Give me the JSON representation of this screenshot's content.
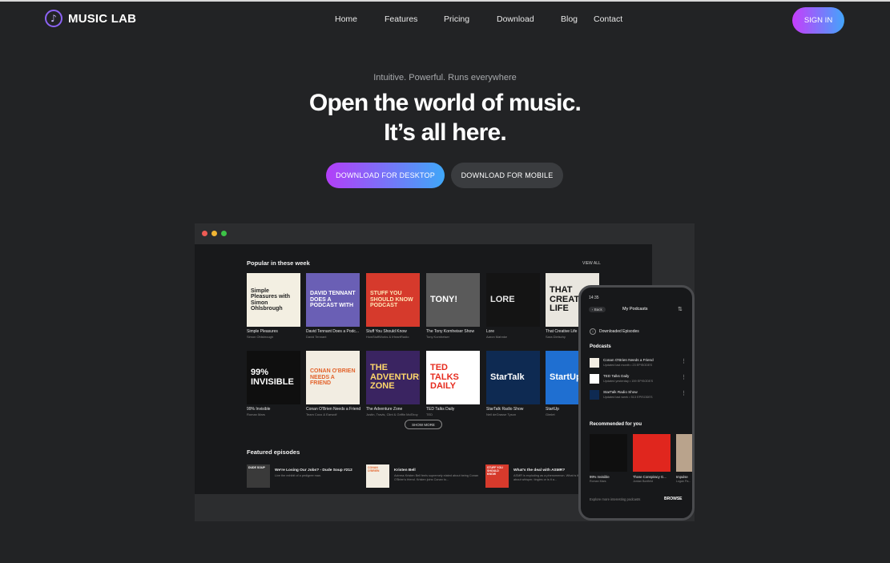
{
  "app": {
    "name": "MUSIC LAB"
  },
  "nav": {
    "items": [
      "Home",
      "Features",
      "Pricing",
      "Download",
      "Blog",
      "Contact"
    ]
  },
  "header": {
    "signin_label": "SIGN IN"
  },
  "hero": {
    "eyebrow": "Intuitive. Powerful. Runs everywhere",
    "headline_line1": "Open the world of music.",
    "headline_line2": "It’s all here.",
    "cta_desktop": "DOWNLOAD FOR DESKTOP",
    "cta_mobile": "DOWNLOAD FOR MOBILE"
  },
  "desktop_app": {
    "popular_title": "Popular in these week",
    "view_all": "VIEW ALL",
    "show_more": "SHOW MORE",
    "featured_title": "Featured episodes",
    "podcasts": [
      {
        "title": "Simple Pleasures",
        "author": "Simon Ohlsbrough",
        "art": "Simple Pleasures with Simon Ohlsbrough",
        "bg": "#f3efe2",
        "fg": "#222"
      },
      {
        "title": "David Tennant Does a Podc...",
        "author": "David Tennant",
        "art": "DAVID TENNANT DOES A PODCAST WITH",
        "bg": "#6a5fb5",
        "fg": "#ffffff"
      },
      {
        "title": "Stuff You Should Know",
        "author": "HowStuffWorks & iHeartRadio",
        "art": "STUFF YOU SHOULD KNOW PODCAST",
        "bg": "#d63a2c",
        "fg": "#ffe8b8"
      },
      {
        "title": "The Tony Kornheiser Show",
        "author": "Tony Kornheiser",
        "art": "TONY!",
        "bg": "#5a5a5a",
        "fg": "#ffffff"
      },
      {
        "title": "Lore",
        "author": "Aaron Mahnke",
        "art": "LORE",
        "bg": "#141414",
        "fg": "#e6e6e6"
      },
      {
        "title": "That Creative Life",
        "author": "Sara Dietschy",
        "art": "THAT CREATIVE LIFE",
        "bg": "#e9e6df",
        "fg": "#111111"
      },
      {
        "title": "99% Invisible",
        "author": "Roman Mars",
        "art": "99% INVISIBLE",
        "bg": "#0f0f0f",
        "fg": "#ffffff"
      },
      {
        "title": "Conan O'Brien Needs a Friend",
        "author": "Team Coco & Earwolf",
        "art": "CONAN O'BRIEN NEEDS A FRIEND",
        "bg": "#f2ede2",
        "fg": "#e3632b"
      },
      {
        "title": "The Adventure Zone",
        "author": "Justin, Travis, Clint & Griffin McElroy",
        "art": "THE ADVENTURE ZONE",
        "bg": "#3a2461",
        "fg": "#ffd86b"
      },
      {
        "title": "TED Talks Daily",
        "author": "TED",
        "art": "TED TALKS DAILY",
        "bg": "#ffffff",
        "fg": "#e62b1e"
      },
      {
        "title": "StarTalk Radio Show",
        "author": "Neil deGrasse Tyson",
        "art": "StarTalk",
        "bg": "#0e2a52",
        "fg": "#ffffff"
      },
      {
        "title": "StartUp",
        "author": "Gimlet",
        "art": "StartUp",
        "bg": "#1f6fd1",
        "fg": "#ffffff"
      }
    ],
    "featured": [
      {
        "show": "DUDE SOUP",
        "title": "We're Losing Our Jobs? - Dude Soup #212",
        "desc": "Live the exhibit of a pedigree man.",
        "bg": "#3a3a3a"
      },
      {
        "show": "CONAN O'BRIEN",
        "title": "Kristen Bell",
        "desc": "Actress Kristen Bell feels supremely elated about being Conan O'Brien's friend. Kristen joins Conan to...",
        "bg": "#f2ede2"
      },
      {
        "show": "STUFF YOU SHOULD KNOW",
        "title": "What's the deal with ASMR?",
        "desc": "ASMR is exploding as a phenomenon. What is it exactly? Is it about whisper, tingles or is it a...",
        "bg": "#d63a2c"
      }
    ]
  },
  "mobile_app": {
    "time": "14:35",
    "back_label": "Back",
    "title": "My Podcasts",
    "downloaded": "Downloaded Episodes",
    "podcasts_title": "Podcasts",
    "list": [
      {
        "title": "Conan O'Brien Needs a Friend",
        "meta": "Updated last month • 23 EPISODES",
        "bg": "#f2ede2"
      },
      {
        "title": "TED Talks Daily",
        "meta": "Updated yesterday • 159 EPISODES",
        "bg": "#ffffff"
      },
      {
        "title": "StarTalk Radio Show",
        "meta": "Updated last week • 513 EPISODES",
        "bg": "#0e2a52"
      }
    ],
    "recommended_title": "Recommended for you",
    "recommended": [
      {
        "title": "99% Invisible",
        "author": "Roman Mars",
        "bg": "#0f0f0f",
        "fg": "#ffffff"
      },
      {
        "title": "Those Conspiracy G...",
        "author": "Jordan Bonfield",
        "bg": "#e0261e",
        "fg": "#ffffff"
      },
      {
        "title": "Impulse",
        "author": "Logan Pa...",
        "bg": "#b9a38c",
        "fg": "#222"
      }
    ],
    "explore_text": "Explore more interesting podcasts",
    "browse": "BROWSE"
  },
  "colors": {
    "background": "#222325",
    "gradient_start": "#c63dfb",
    "gradient_end": "#43a5fb",
    "window_dots": [
      "#ee5b54",
      "#f1b533",
      "#3cc347"
    ]
  }
}
